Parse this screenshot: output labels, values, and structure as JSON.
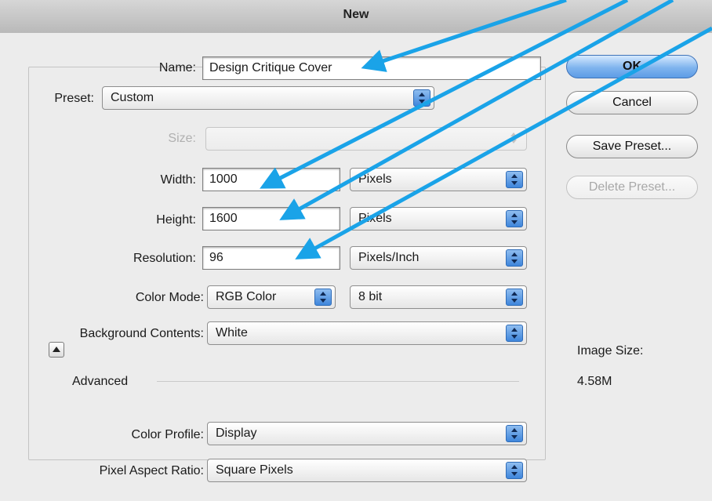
{
  "window": {
    "title": "New"
  },
  "name": {
    "label": "Name:",
    "value": "Design Critique Cover"
  },
  "preset": {
    "label": "Preset:",
    "value": "Custom"
  },
  "size": {
    "label": "Size:",
    "value": ""
  },
  "width": {
    "label": "Width:",
    "value": "1000",
    "unit": "Pixels"
  },
  "height": {
    "label": "Height:",
    "value": "1600",
    "unit": "Pixels"
  },
  "resolution": {
    "label": "Resolution:",
    "value": "96",
    "unit": "Pixels/Inch"
  },
  "color_mode": {
    "label": "Color Mode:",
    "value": "RGB Color",
    "depth": "8 bit"
  },
  "background": {
    "label": "Background Contents:",
    "value": "White"
  },
  "advanced": {
    "label": "Advanced"
  },
  "color_profile": {
    "label": "Color Profile:",
    "value": "Display"
  },
  "pixel_aspect": {
    "label": "Pixel Aspect Ratio:",
    "value": "Square Pixels"
  },
  "buttons": {
    "ok": "OK",
    "cancel": "Cancel",
    "save_preset": "Save Preset...",
    "delete_preset": "Delete Preset..."
  },
  "image_size": {
    "label": "Image Size:",
    "value": "4.58M"
  },
  "annotation": {
    "arrow_color": "#1aa3e8"
  }
}
